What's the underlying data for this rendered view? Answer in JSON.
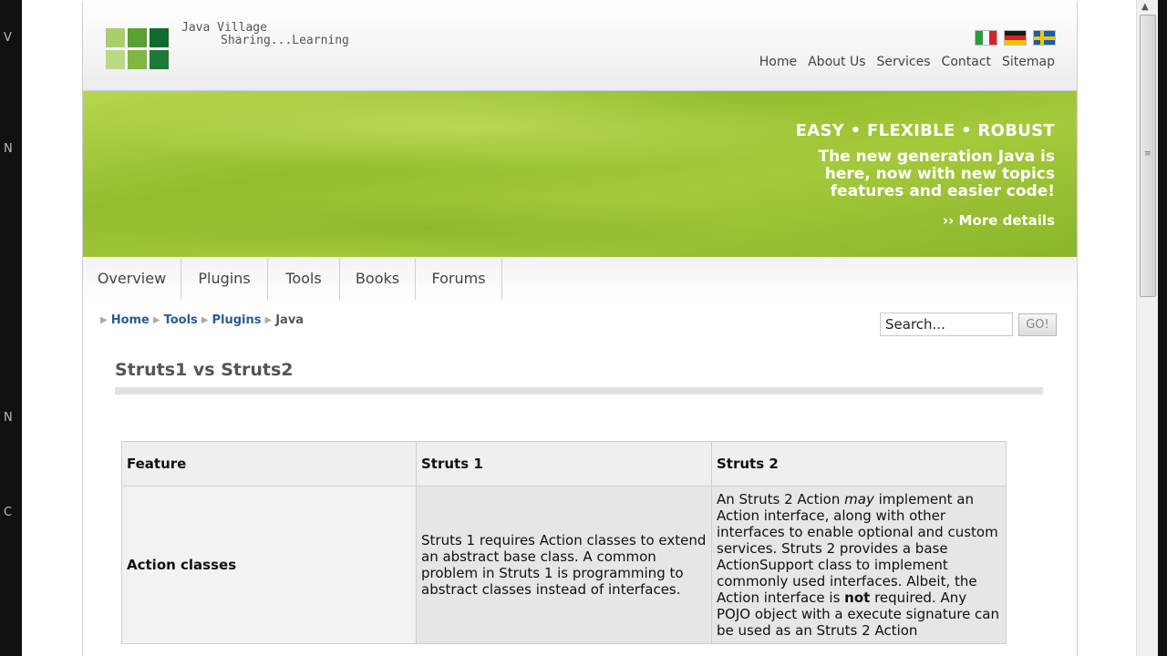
{
  "backdrop": {
    "fragments": [
      "V",
      "N",
      "N",
      "C"
    ]
  },
  "header": {
    "tagline_1": "Java Village",
    "tagline_2": "Sharing...Learning",
    "flags": [
      "italy-flag",
      "germany-flag",
      "sweden-flag"
    ],
    "nav": [
      "Home",
      "About Us",
      "Services",
      "Contact",
      "Sitemap"
    ]
  },
  "banner": {
    "slogan": "EASY • FLEXIBLE • ROBUST",
    "desc_line_1": "The new generation Java is",
    "desc_line_2": "here, now with new topics",
    "desc_line_3": "features and easier code!",
    "more": "›› More details"
  },
  "menu": {
    "tabs": [
      "Overview",
      "Plugins",
      "Tools",
      "Books",
      "Forums"
    ]
  },
  "breadcrumb": {
    "items": [
      "Home",
      "Tools",
      "Plugins",
      "Java"
    ]
  },
  "search": {
    "value": "Search...",
    "button": "GO!"
  },
  "content": {
    "title": "Struts1 vs Struts2",
    "table": {
      "headers": [
        "Feature",
        "Struts 1",
        "Struts 2"
      ],
      "row1": {
        "feature": "Action classes",
        "struts1": "Struts 1 requires Action classes to extend an abstract base class. A common problem in Struts 1 is programming to abstract classes instead of interfaces.",
        "struts2_a": "An Struts 2 Action ",
        "struts2_em": "may",
        "struts2_b": " implement an Action interface, along with other interfaces to enable optional and custom services. Struts 2 provides a base ActionSupport class to implement commonly used interfaces. Albeit, the Action interface is ",
        "struts2_strong": "not",
        "struts2_c": " required. Any POJO object with a execute signature can be used as an Struts 2 Action"
      }
    }
  },
  "colors": {
    "banner_green": "#9cc535",
    "link_blue": "#2a5c8f",
    "logo_dark": "#0f6b2e",
    "logo_mid": "#5aa032",
    "logo_light": "#a8d06a"
  }
}
